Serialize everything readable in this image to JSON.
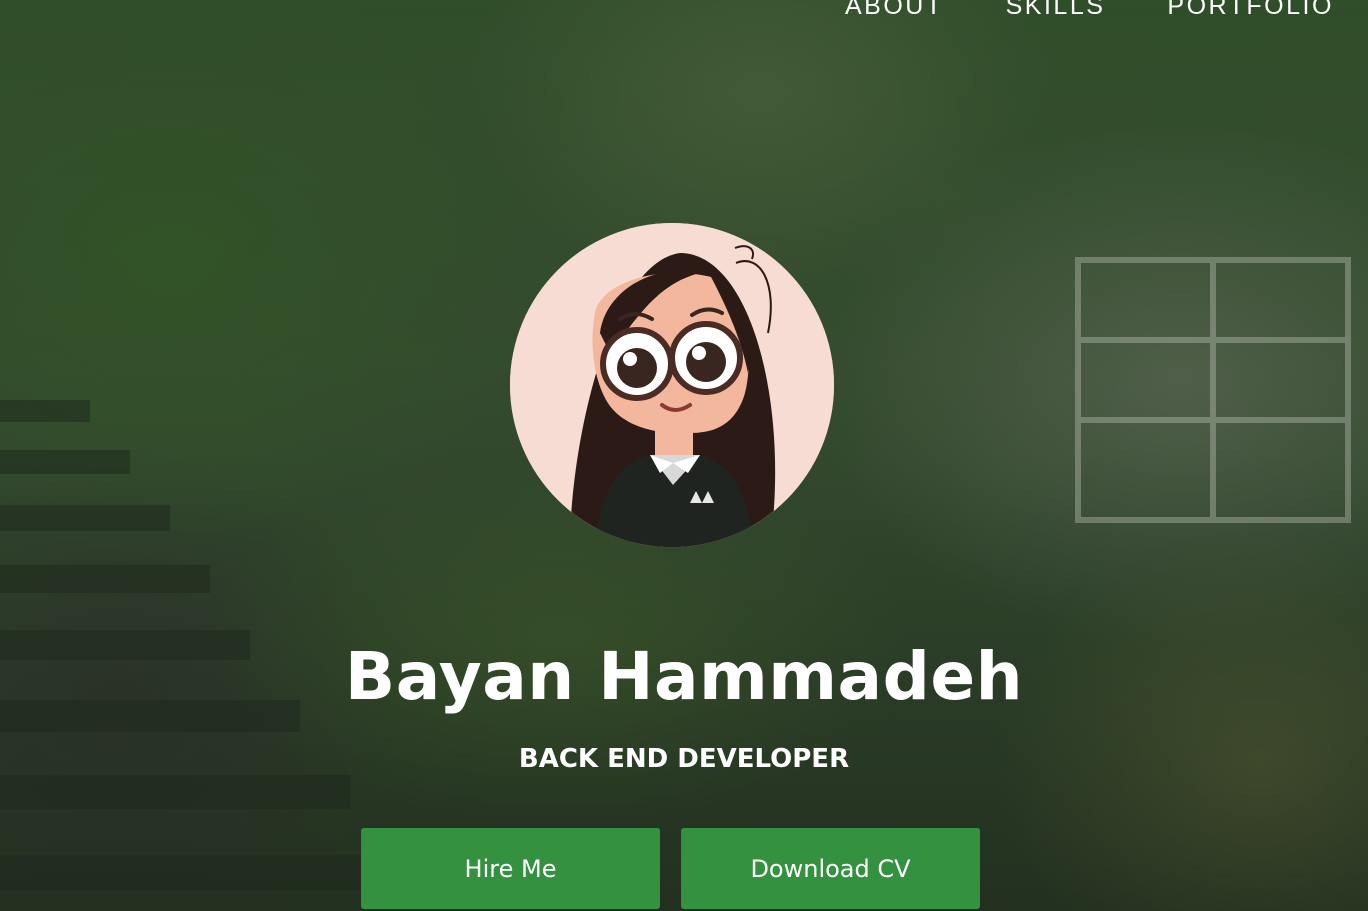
{
  "nav": {
    "items": [
      {
        "label": "ABOUT"
      },
      {
        "label": "SKILLS"
      },
      {
        "label": "PORTFOLIO"
      }
    ]
  },
  "hero": {
    "name": "Bayan Hammadeh",
    "role": "BACK END DEVELOPER",
    "buttons": {
      "hire": "Hire Me",
      "download_cv": "Download CV"
    },
    "avatar_icon": "cartoon-girl-with-glasses-avatar"
  },
  "colors": {
    "button_green": "#34913f",
    "text": "#ffffff",
    "avatar_bg": "#f6dcd2"
  }
}
